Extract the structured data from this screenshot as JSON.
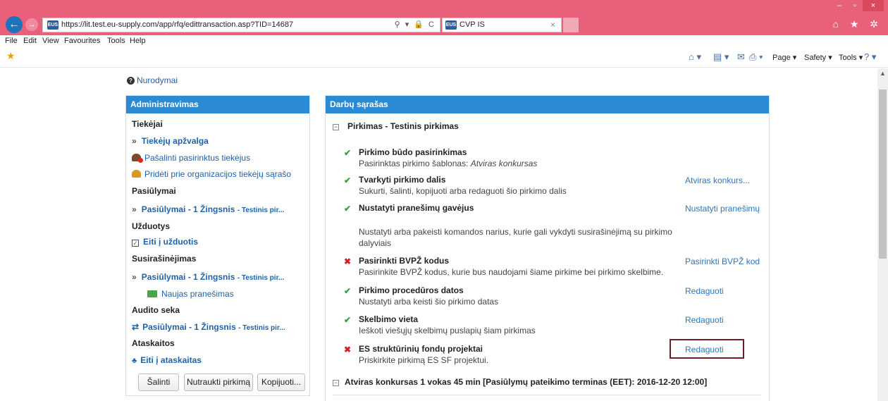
{
  "browser": {
    "url": "https://lit.test.eu-supply.com/app/rfq/edittransaction.asp?TID=14687",
    "tab_title": "CVP IS",
    "site_icon_text": "EUS",
    "back_glyph": "←",
    "forward_glyph": "→",
    "address_tools": "⚲ ▾ 🔒 C",
    "tab_close": "×",
    "window_controls": [
      "–",
      "▫",
      "×"
    ],
    "right_icons": "⌂ ★ ✲",
    "menu": [
      "File",
      "Edit",
      "View",
      "Favourites",
      "Tools",
      "Help"
    ],
    "commands": [
      "Page ▾",
      "Safety ▾",
      "Tools ▾"
    ],
    "command_icons": [
      "⌂ ▾",
      "▤ ▾",
      "✉",
      "⎙ ▾",
      "? ▾"
    ]
  },
  "help": {
    "label": "Nurodymai",
    "icon": "question-circle-icon",
    "icon_glyph": "?"
  },
  "admin": {
    "header": "Administravimas",
    "sections": {
      "tiekejai": "Tiekėjai",
      "pasiulymai": "Pasiūlymai",
      "uzduotys": "Užduotys",
      "susirasinejimas": "Susirašinėjimas",
      "audito_seka": "Audito seka",
      "ataskaitos": "Ataskaitos"
    },
    "links": {
      "tiekeju_apzvalga": "Tiekėjų apžvalga",
      "pasalinti": "Pašalinti pasirinktus tiekėjus",
      "prideti": "Pridėti prie organizacijos tiekėjų sąrašo",
      "pasiulymai_step": "Pasiūlymai - 1 Žingsnis",
      "step_suffix": "- Testinis pir...",
      "eiti_uzduotis": "Eiti į užduotis",
      "naujas_pranesimas": "Naujas pranešimas",
      "eiti_ataskaitas": "Eiti į ataskaitas"
    },
    "glyphs": {
      "chevron": "»",
      "check": "✓",
      "arrows": "⇄",
      "tree": "♣"
    },
    "buttons": {
      "salinti": "Šalinti",
      "nutraukti": "Nutraukti pirkimą",
      "kopijuoti": "Kopijuoti..."
    }
  },
  "work": {
    "header": "Darbų sąrašas",
    "collapse_glyph": "−",
    "group1": "Pirkimas - Testinis pirkimas",
    "group2": "Atviras konkursas 1 vokas 45 min [Pasiūlymų pateikimo terminas (EET): 2016-12-20 12:00]",
    "marks": {
      "ok": "✔",
      "no": "✖"
    },
    "tasks": [
      {
        "status": "done",
        "title": "Pirkimo būdo pasirinkimas",
        "desc": "Pasirinktas pirkimo šablonas: ",
        "desc_em": "Atviras konkursas",
        "action": ""
      },
      {
        "status": "done",
        "title": "Tvarkyti pirkimo dalis",
        "desc": "Sukurti, šalinti, kopijuoti arba redaguoti šio pirkimo dalis",
        "action": "Atviras konkurs..."
      },
      {
        "status": "done",
        "title": "Nustatyti pranešimų gavėjus",
        "desc": "Nustatyti arba pakeisti komandos narius, kurie gali vykdyti susirašinėjimą su pirkimo",
        "desc2": "dalyviais",
        "action": "Nustatyti pranešimų"
      },
      {
        "status": "todo",
        "title": "Pasirinkti BVPŽ kodus",
        "desc": "Pasirinkite BVPŽ kodus, kurie bus naudojami šiame pirkime bei pirkimo skelbime.",
        "action": "Pasirinkti BVPŽ kod"
      },
      {
        "status": "done",
        "title": "Pirkimo procedūros datos",
        "desc": "Nustatyti arba keisti šio pirkimo datas",
        "action": "Redaguoti"
      },
      {
        "status": "done",
        "title": "Skelbimo vieta",
        "desc": "Ieškoti viešųjų skelbimų puslapių šiam pirkimas",
        "action": "Redaguoti"
      },
      {
        "status": "todo",
        "title": "ES struktūrinių fondų projektai",
        "desc": "Priskirkite pirkimą ES SF projektui.",
        "action": "Redaguoti"
      }
    ]
  },
  "colors": {
    "chrome": "#e8607a",
    "panel_header": "#2a8ad3",
    "link": "#1f62a8",
    "ok": "#3aa03a",
    "error": "#d42020",
    "highlight": "#6e1d2a"
  }
}
